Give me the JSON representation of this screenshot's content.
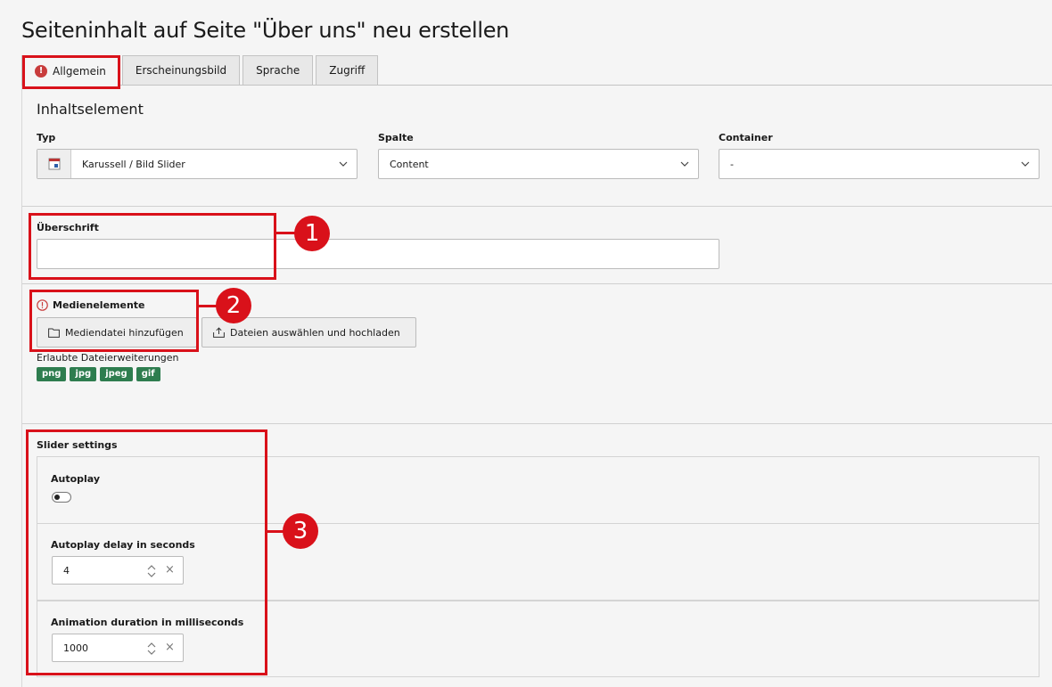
{
  "page": {
    "title": "Seiteninhalt auf Seite \"Über uns\" neu erstellen"
  },
  "tabs": [
    {
      "label": "Allgemein",
      "active": true,
      "error": true
    },
    {
      "label": "Erscheinungsbild"
    },
    {
      "label": "Sprache"
    },
    {
      "label": "Zugriff"
    }
  ],
  "inhaltselement": {
    "heading": "Inhaltselement",
    "typ": {
      "label": "Typ",
      "value": "Karussell / Bild Slider",
      "icon": "content-type-icon"
    },
    "spalte": {
      "label": "Spalte",
      "value": "Content"
    },
    "container": {
      "label": "Container",
      "value": "-"
    }
  },
  "ueberschrift": {
    "label": "Überschrift",
    "value": ""
  },
  "medien": {
    "label": "Medienelemente",
    "add_button": "Mediendatei hinzufügen",
    "upload_button": "Dateien auswählen und hochladen",
    "allowed_label": "Erlaubte Dateierweiterungen",
    "extensions": [
      "png",
      "jpg",
      "jpeg",
      "gif"
    ],
    "badge_color": "#2e7d4f"
  },
  "slider": {
    "heading": "Slider settings",
    "autoplay": {
      "label": "Autoplay",
      "enabled": false
    },
    "delay": {
      "label": "Autoplay delay in seconds",
      "value": "4"
    },
    "duration": {
      "label": "Animation duration in milliseconds",
      "value": "1000"
    }
  },
  "annotations": [
    "1",
    "2",
    "3"
  ],
  "colors": {
    "annotation": "#d9111a",
    "error": "#c83c3c"
  }
}
